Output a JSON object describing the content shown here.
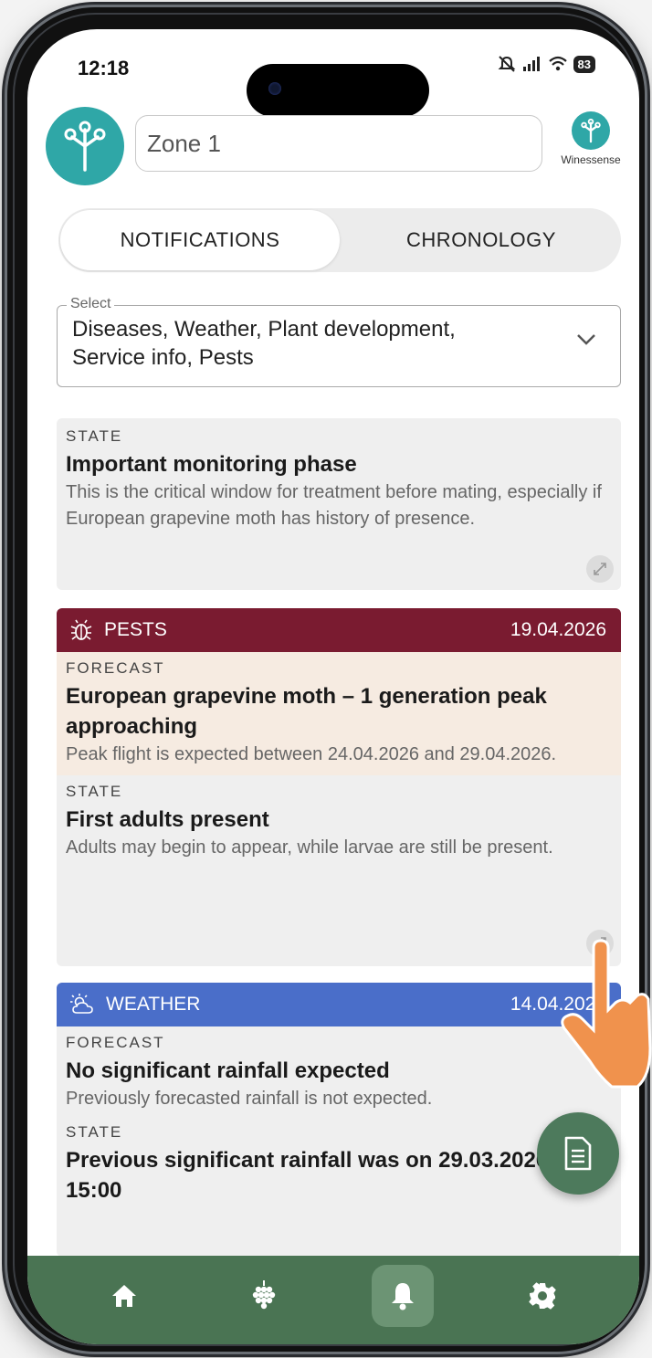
{
  "status_bar": {
    "time": "12:18",
    "battery": "83"
  },
  "header": {
    "zone_value": "Zone 1",
    "brand_name": "Winessense"
  },
  "tabs": [
    {
      "label": "NOTIFICATIONS",
      "active": true
    },
    {
      "label": "CHRONOLOGY",
      "active": false
    }
  ],
  "filter": {
    "legend": "Select",
    "value_line1": "Diseases, Weather, Plant development,",
    "value_line2": "Service info, Pests"
  },
  "cards": {
    "first": {
      "state_type": "STATE",
      "state_title": "Important monitoring phase",
      "state_body": "This is the critical window for treatment before mating, especially if European grapevine moth has history of presence."
    },
    "pests": {
      "color": "#7a1b30",
      "icon": "bug-icon",
      "category": "PESTS",
      "date": "19.04.2026",
      "forecast_type": "FORECAST",
      "forecast_title": "European grapevine moth – 1 generation peak approaching",
      "forecast_body": "Peak flight is expected between 24.04.2026 and 29.04.2026.",
      "state_type": "STATE",
      "state_title": "First adults present",
      "state_body": "Adults may begin to appear, while larvae are still be present."
    },
    "weather": {
      "color": "#4a6ec9",
      "icon": "sun-cloud-icon",
      "category": "WEATHER",
      "date": "14.04.2026",
      "forecast_type": "FORECAST",
      "forecast_title": "No significant rainfall expected",
      "forecast_body": "Previously forecasted rainfall is not expected.",
      "state_type": "STATE",
      "state_title": "Previous significant rainfall was on 29.03.2026 at 15:00"
    }
  },
  "nav": {
    "items": [
      "home-icon",
      "grape-icon",
      "bell-icon",
      "gear-icon"
    ],
    "active": "bell-icon",
    "color": "#4a7453"
  },
  "fab_icon": "document-icon",
  "accent_teal": "#2fa7a7"
}
